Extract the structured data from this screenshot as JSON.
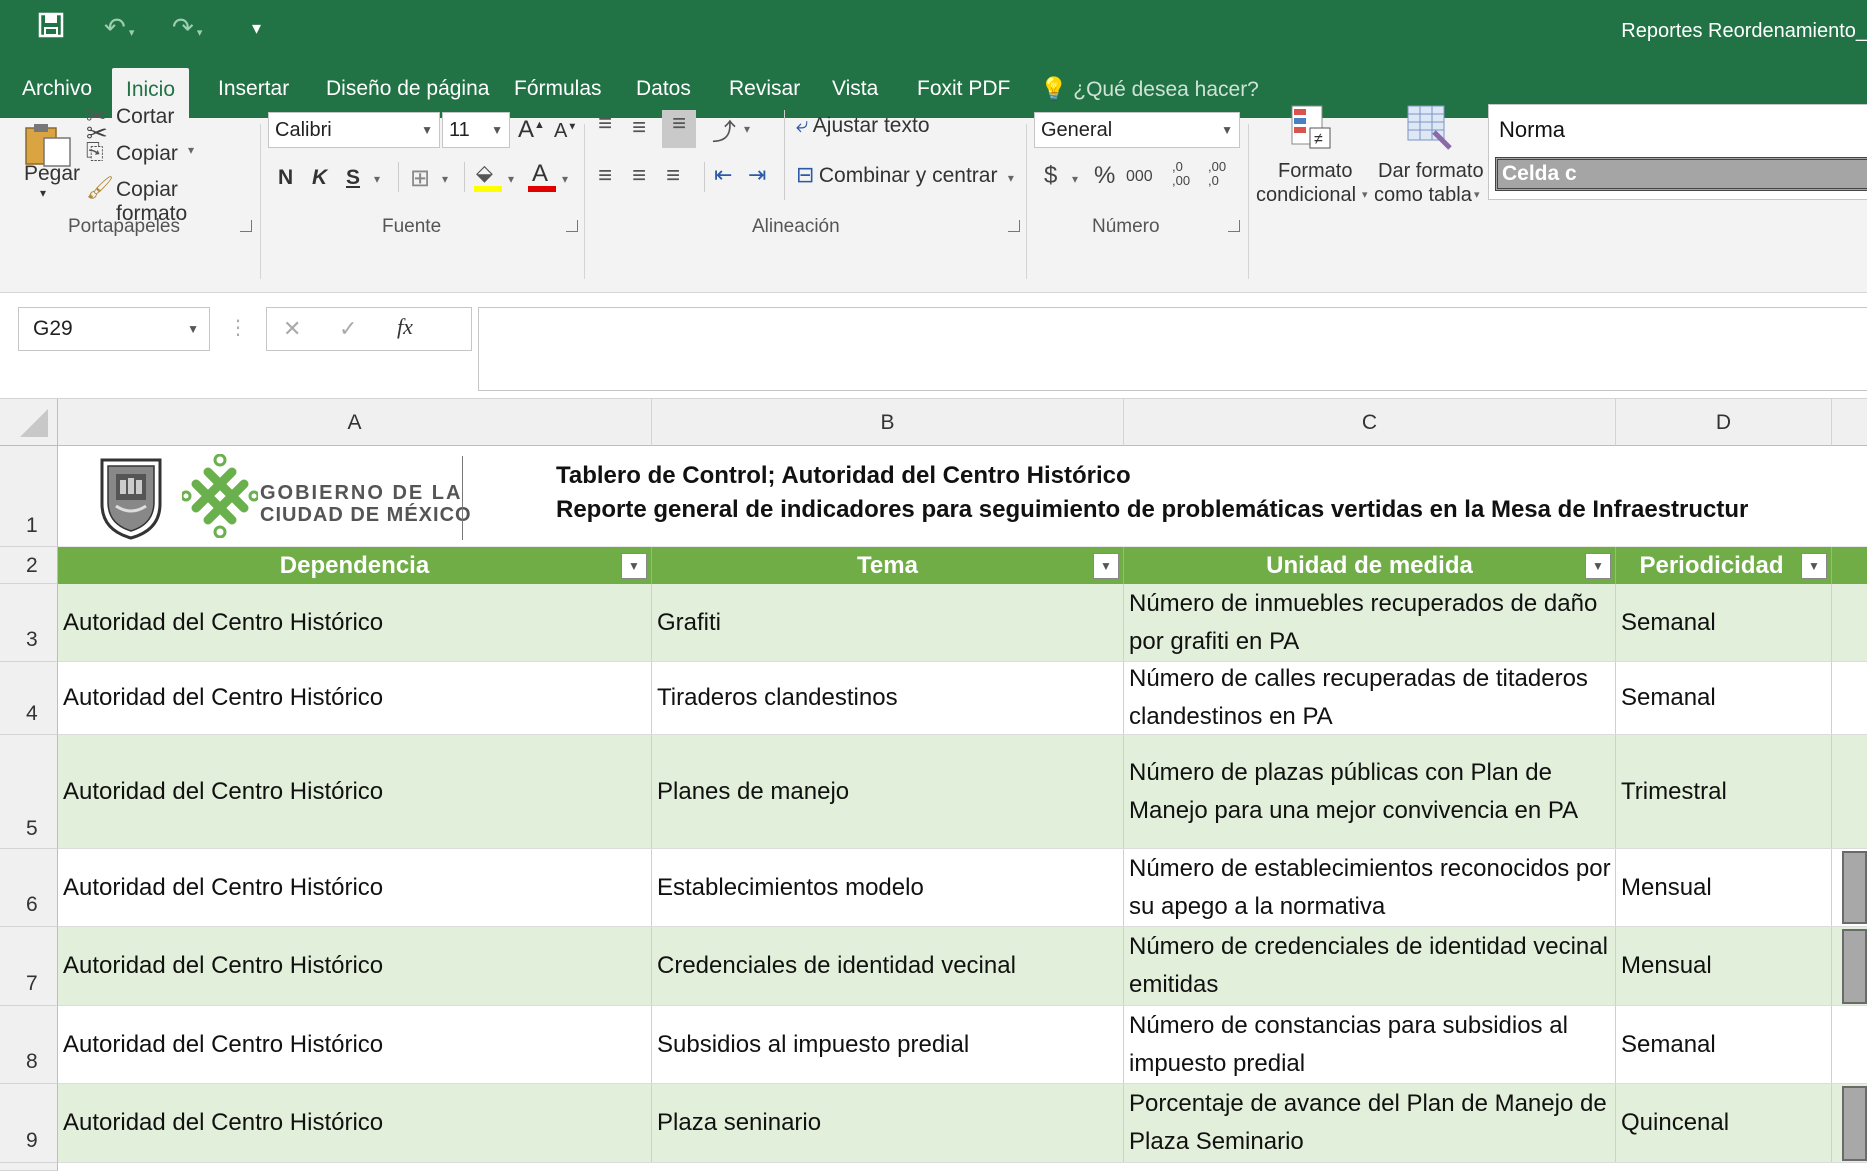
{
  "app": {
    "title": "Reportes Reordenamiento_",
    "tabs": [
      "Archivo",
      "Inicio",
      "Insertar",
      "Diseño de página",
      "Fórmulas",
      "Datos",
      "Revisar",
      "Vista",
      "Foxit PDF"
    ],
    "tell_me": "¿Qué desea hacer?"
  },
  "ribbon": {
    "portapapeles": {
      "paste": "Pegar",
      "cut": "Cortar",
      "copy": "Copiar",
      "format_painter": "Copiar formato",
      "label": "Portapapeles"
    },
    "fuente": {
      "font": "Calibri",
      "size": "11",
      "bold": "N",
      "italic": "K",
      "underline": "S",
      "label": "Fuente",
      "grow": "A",
      "shrink": "A",
      "font_color": "A"
    },
    "alineacion": {
      "wrap": "Ajustar texto",
      "merge": "Combinar y centrar",
      "label": "Alineación"
    },
    "numero": {
      "format": "General",
      "currency": "$",
      "percent": "%",
      "thousands": "000",
      "inc_decimals": ",0\n,00",
      "dec_decimals": ",00\n,0",
      "label": "Número"
    },
    "estilos": {
      "cond_format_1": "Formato",
      "cond_format_2": "condicional",
      "table_format_1": "Dar formato",
      "table_format_2": "como tabla",
      "style_normal": "Norma",
      "style_celda": "Celda c"
    }
  },
  "formula_bar": {
    "name_box": "G29",
    "cancel": "✕",
    "enter": "✓",
    "fx": "fx",
    "value": ""
  },
  "sheet": {
    "columns": [
      "A",
      "B",
      "C",
      "D"
    ],
    "rows": [
      "1",
      "2",
      "3",
      "4",
      "5",
      "6",
      "7",
      "8",
      "9"
    ],
    "logo": {
      "line1": "GOBIERNO DE LA",
      "line2": "CIUDAD DE MÉXICO"
    },
    "title1": "Tablero de Control; Autoridad del Centro Histórico",
    "title2": "Reporte general de indicadores para seguimiento de problemáticas vertidas en la Mesa de Infraestructur",
    "headers": [
      "Dependencia",
      "Tema",
      "Unidad de medida",
      "Periodicidad"
    ],
    "data": [
      {
        "dependencia": "Autoridad del Centro Histórico",
        "tema": "Grafiti",
        "unidad": "Número de inmuebles recuperados de daño por grafiti en PA",
        "periodicidad": "Semanal"
      },
      {
        "dependencia": "Autoridad del Centro Histórico",
        "tema": "Tiraderos clandestinos",
        "unidad": "Número de calles recuperadas de titaderos clandestinos en PA",
        "periodicidad": "Semanal"
      },
      {
        "dependencia": "Autoridad del Centro Histórico",
        "tema": "Planes de manejo",
        "unidad": "Número de plazas públicas con Plan de Manejo para una mejor convivencia en PA",
        "periodicidad": "Trimestral"
      },
      {
        "dependencia": "Autoridad del Centro Histórico",
        "tema": "Establecimientos modelo",
        "unidad": "Número de establecimientos reconocidos por su apego a la normativa",
        "periodicidad": "Mensual"
      },
      {
        "dependencia": "Autoridad del Centro Histórico",
        "tema": "Credenciales de identidad vecinal",
        "unidad": "Número de credenciales de identidad vecinal emitidas",
        "periodicidad": "Mensual"
      },
      {
        "dependencia": "Autoridad del Centro Histórico",
        "tema": "Subsidios al impuesto predial",
        "unidad": "Número de constancias para subsidios al impuesto predial",
        "periodicidad": "Semanal"
      },
      {
        "dependencia": "Autoridad del Centro Histórico",
        "tema": "Plaza seninario",
        "unidad": "Porcentaje de avance del Plan de Manejo de Plaza Seminario",
        "periodicidad": "Quincenal"
      }
    ]
  },
  "colors": {
    "excel_green": "#217346",
    "header_green": "#70ad47",
    "band_green": "#e2efda",
    "logo_green": "#6ab04c"
  }
}
